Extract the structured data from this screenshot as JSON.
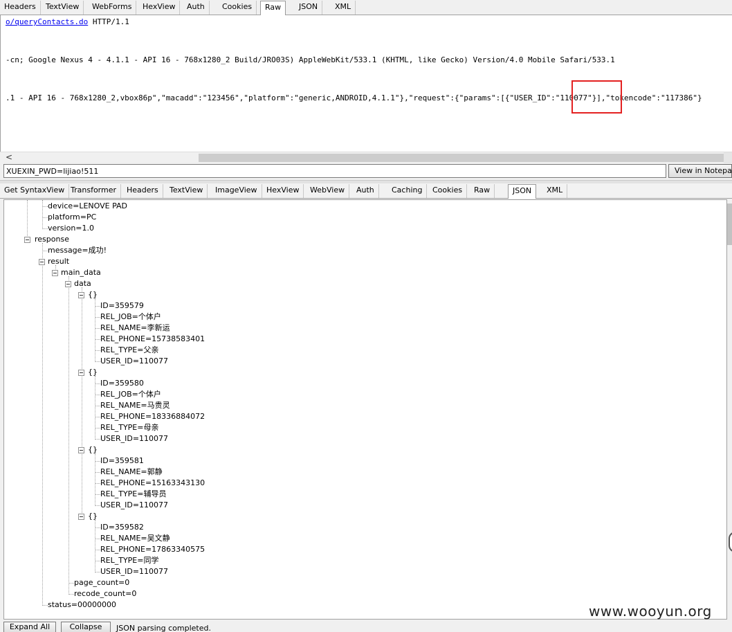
{
  "request_tabs": [
    "Headers",
    "TextView",
    "WebForms",
    "HexView",
    "Auth",
    "Cookies",
    "Raw",
    "JSON",
    "XML"
  ],
  "request_active_tab": "Raw",
  "raw": {
    "line1_link": "o/queryContacts.do",
    "line1_rest": " HTTP/1.1",
    "line2": "-cn; Google Nexus 4 - 4.1.1 - API 16 - 768x1280_2 Build/JRO03S) AppleWebKit/533.1 (KHTML, like Gecko) Version/4.0 Mobile Safari/533.1",
    "line3": ".1 - API 16 - 768x1280_2,vbox86p\",\"macadd\":\"123456\",\"platform\":\"generic,ANDROID,4.1.1\"},\"request\":{\"params\":[{\"USER_ID\":\"110077\"}],\"tokencode\":\"117386\"}"
  },
  "find": {
    "value": "XUEXIN_PWD=lijiao!511",
    "notepad_label": "View in Notepad"
  },
  "response_tabs": [
    "Get SyntaxView",
    "Transformer",
    "Headers",
    "TextView",
    "ImageView",
    "HexView",
    "WebView",
    "Auth",
    "Caching",
    "Cookies",
    "Raw",
    "JSON",
    "XML"
  ],
  "response_active_tab": "JSON",
  "tree": {
    "device": "device=LENOVE PAD",
    "platform": "platform=PC",
    "version": "version=1.0",
    "response": "response",
    "message": "message=成功!",
    "result": "result",
    "main_data": "main_data",
    "data": "data",
    "records": [
      {
        "label": "{}",
        "fields": [
          "ID=359579",
          "REL_JOB=个体户",
          "REL_NAME=李新运",
          "REL_PHONE=15738583401",
          "REL_TYPE=父亲",
          "USER_ID=110077"
        ]
      },
      {
        "label": "{}",
        "fields": [
          "ID=359580",
          "REL_JOB=个体户",
          "REL_NAME=马贵灵",
          "REL_PHONE=18336884072",
          "REL_TYPE=母亲",
          "USER_ID=110077"
        ]
      },
      {
        "label": "{}",
        "fields": [
          "ID=359581",
          "REL_NAME=郭静",
          "REL_PHONE=15163343130",
          "REL_TYPE=辅导员",
          "USER_ID=110077"
        ]
      },
      {
        "label": "{}",
        "fields": [
          "ID=359582",
          "REL_NAME=吴文静",
          "REL_PHONE=17863340575",
          "REL_TYPE=同学",
          "USER_ID=110077"
        ]
      }
    ],
    "page_count": "page_count=0",
    "recode_count": "recode_count=0",
    "status": "status=00000000"
  },
  "bottom": {
    "expand_label": "Expand All",
    "collapse_label": "Collapse",
    "status_text": "JSON parsing completed."
  },
  "watermark": "www.wooyun.org"
}
